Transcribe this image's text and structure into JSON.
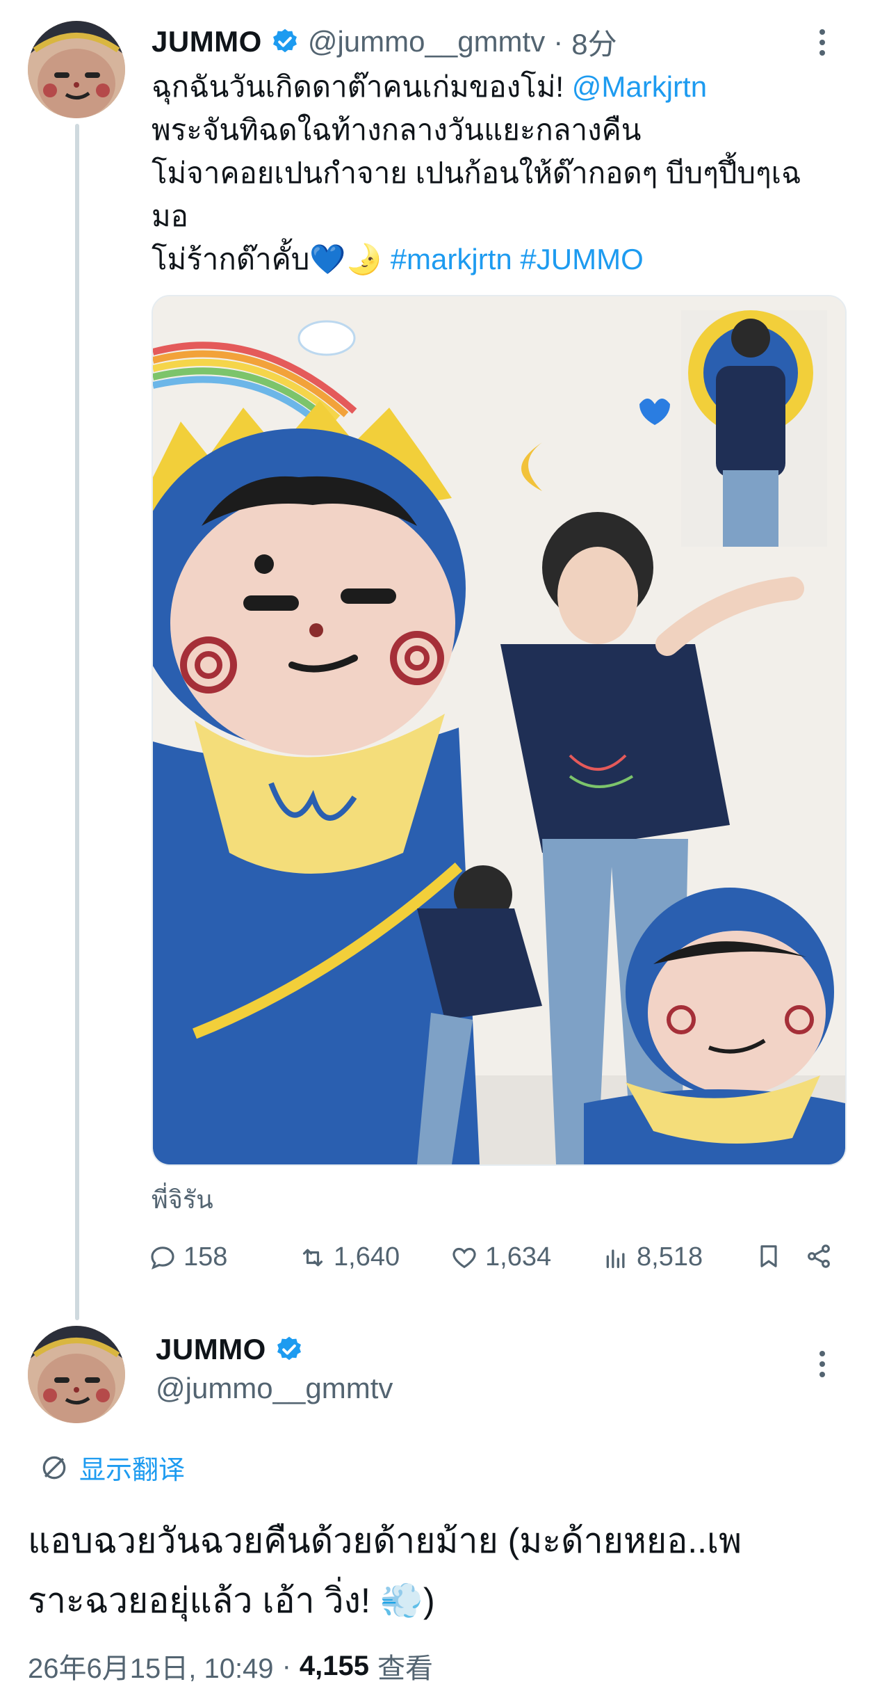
{
  "tweet": {
    "display_name": "JUMMO",
    "handle": "@jummo__gmmtv",
    "separator": "·",
    "time": "8分",
    "lines": [
      "ฉุกฉันวันเกิดดาต๊าคนเก่มของโม่! ",
      "พระจันทิฉดใฉท้างกลางวันแยะกลางคืน",
      "โม่จาคอยเปนกำจาย เปนก้อนให้ด๊ากอดๆ บีบๆปึ้บๆเฉ",
      "มอ",
      "โม่ร้ากด๊าคั้บ💙🌛 "
    ],
    "mention": "@Markjrtn",
    "hashtags": "#markjrtn #JUMMO",
    "photo_caption": "พี่จิรัน",
    "stats": {
      "replies": "158",
      "retweets": "1,640",
      "likes": "1,634",
      "views": "8,518"
    }
  },
  "reply": {
    "display_name": "JUMMO",
    "handle": "@jummo__gmmtv",
    "translate_label": "显示翻译",
    "text_line1": "แอบฉวยวันฉวยคืนด้วยด้ายม้าย (มะด้ายหยอ..เพ",
    "text_line2": "ราะฉวยอยุ่แล้ว เอ้า วิ่ง! 💨)",
    "timestamp": "26年6月15日, 10:49",
    "separator": "·",
    "views_count": "4,155",
    "views_label": "查看"
  },
  "colors": {
    "accent": "#1d9bf0",
    "muted": "#536471",
    "mascot_blue": "#2a5fb0",
    "mascot_yellow": "#f2cf3a"
  },
  "icons": [
    "more-icon",
    "verified-icon",
    "reply-icon",
    "retweet-icon",
    "like-icon",
    "views-icon",
    "bookmark-icon",
    "share-icon",
    "translate-icon"
  ]
}
